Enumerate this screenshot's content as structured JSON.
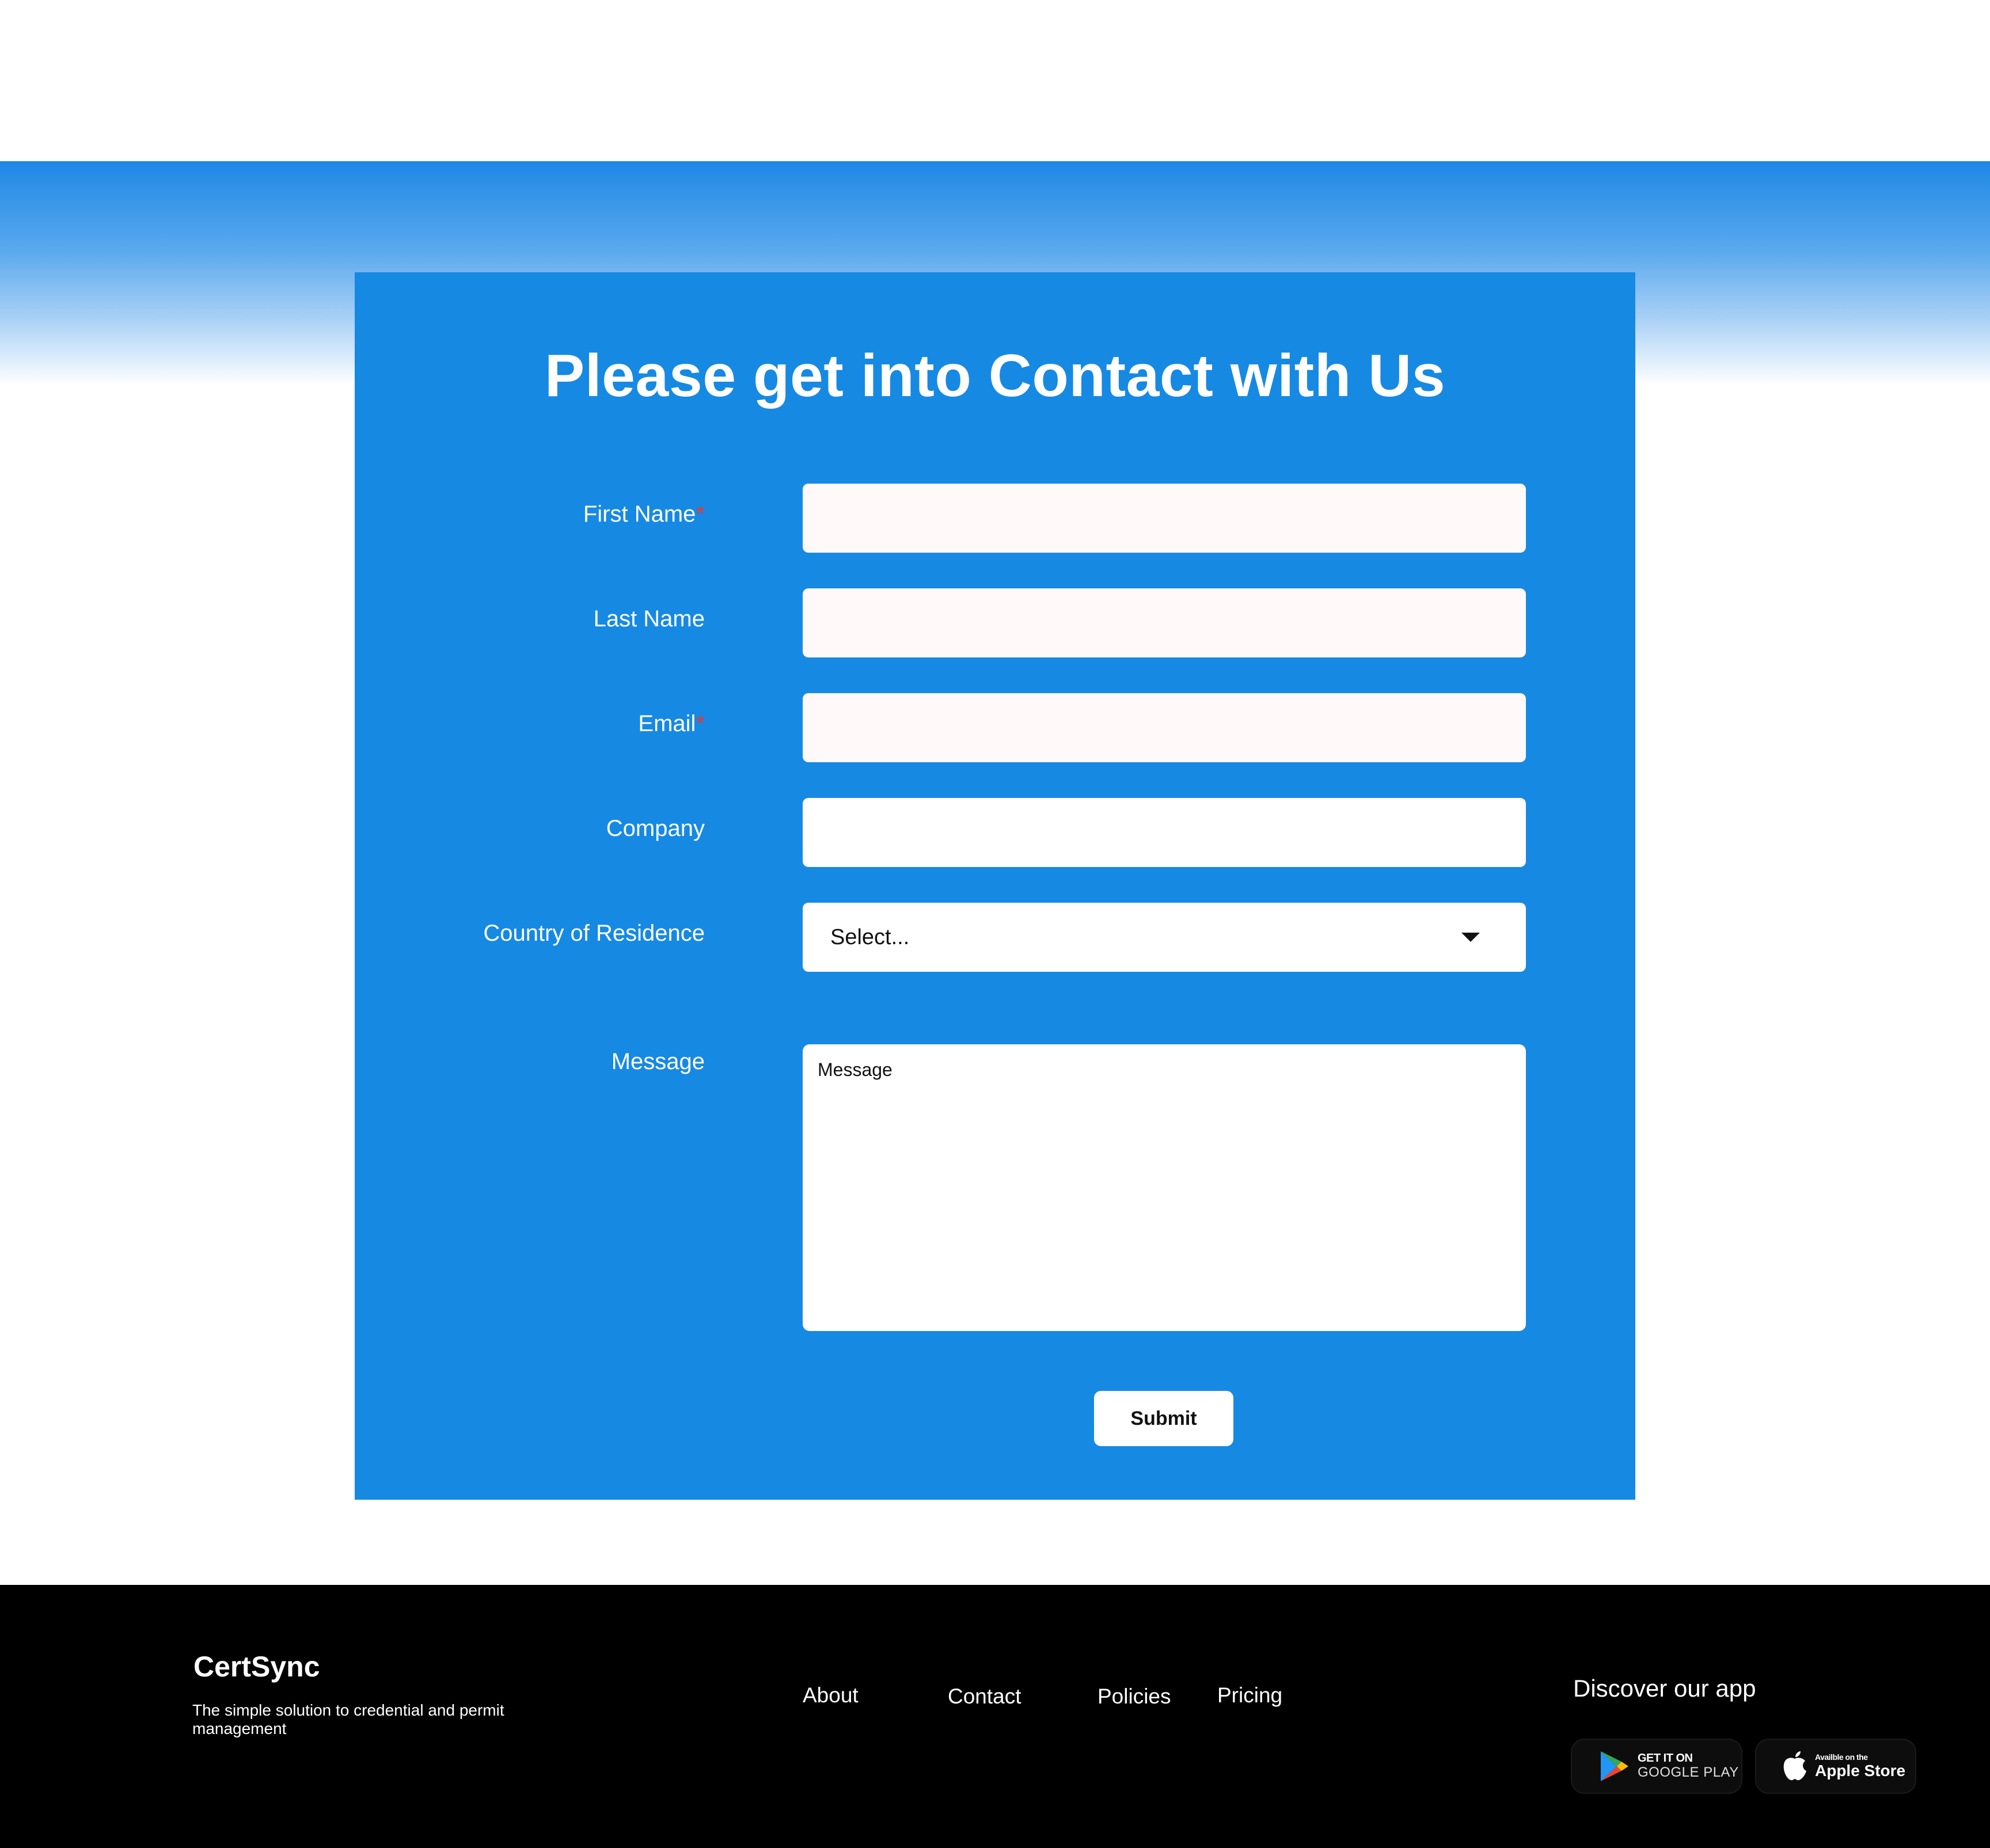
{
  "form": {
    "title": "Please get into Contact with Us",
    "required_marker": "*",
    "fields": {
      "first_name": {
        "label": "First Name",
        "required": true,
        "value": ""
      },
      "last_name": {
        "label": "Last Name",
        "required": false,
        "value": ""
      },
      "email": {
        "label": "Email",
        "required": true,
        "value": ""
      },
      "company": {
        "label": "Company",
        "required": false,
        "value": ""
      },
      "country": {
        "label": "Country of Residence",
        "selected": "Select..."
      },
      "message": {
        "label": "Message",
        "placeholder": "Message"
      }
    },
    "submit_label": "Submit"
  },
  "footer": {
    "brand": "CertSync",
    "tagline": "The simple solution to credential and permit management",
    "links": {
      "about": "About",
      "contact": "Contact",
      "policies": "Policies",
      "pricing": "Pricing"
    },
    "discover_title": "Discover our app",
    "badges": {
      "google": {
        "small": "GET IT ON",
        "big": "GOOGLE PLAY",
        "icon": "google-play-icon"
      },
      "apple": {
        "small": "Availble on the",
        "big": "Apple Store",
        "icon": "apple-icon"
      }
    }
  },
  "colors": {
    "card_background": "#1689e3",
    "required_star": "#e53935",
    "footer_background": "#000000"
  }
}
